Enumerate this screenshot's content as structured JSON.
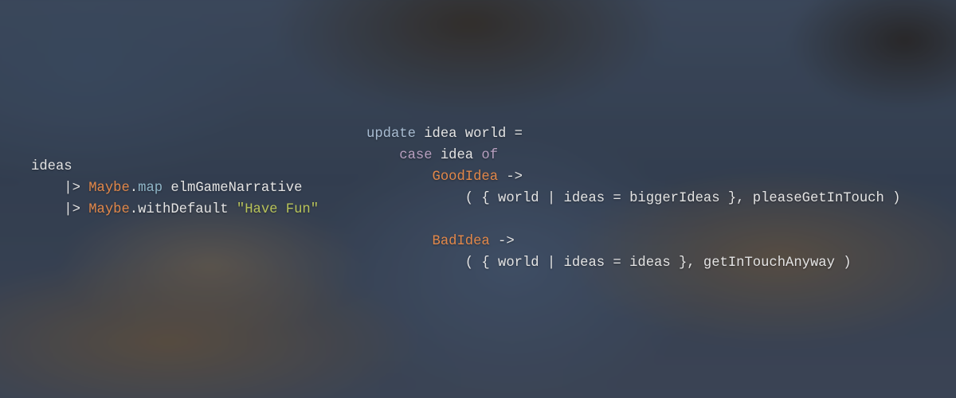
{
  "colors": {
    "text": "#e4e4e4",
    "keyword": "#b8a0c0",
    "update_keyword": "#a9bdd3",
    "type_name": "#e2884a",
    "function_name": "#8fb5c7",
    "string": "#b8c35a"
  },
  "left_snippet": {
    "line1": {
      "text": "ideas"
    },
    "line2": {
      "indent": "    ",
      "pipe": "|> ",
      "module": "Maybe",
      "dot": ".",
      "fn": "map",
      "rest": " elmGameNarrative"
    },
    "line3": {
      "indent": "    ",
      "pipe": "|> ",
      "module": "Maybe",
      "rest": ".withDefault ",
      "string": "\"Have Fun\""
    }
  },
  "right_snippet": {
    "line1": {
      "keyword": "update",
      "rest": " idea world ="
    },
    "line2": {
      "indent": "    ",
      "keyword": "case",
      "mid": " idea ",
      "keyword2": "of"
    },
    "line3": {
      "indent": "        ",
      "ctor": "GoodIdea",
      "rest": " ->"
    },
    "line4": {
      "indent": "            ",
      "text": "( { world | ideas = biggerIdeas }, pleaseGetInTouch )"
    },
    "line5": {
      "text": ""
    },
    "line6": {
      "indent": "        ",
      "ctor": "BadIdea",
      "rest": " ->"
    },
    "line7": {
      "indent": "            ",
      "text": "( { world | ideas = ideas }, getInTouchAnyway )"
    }
  }
}
